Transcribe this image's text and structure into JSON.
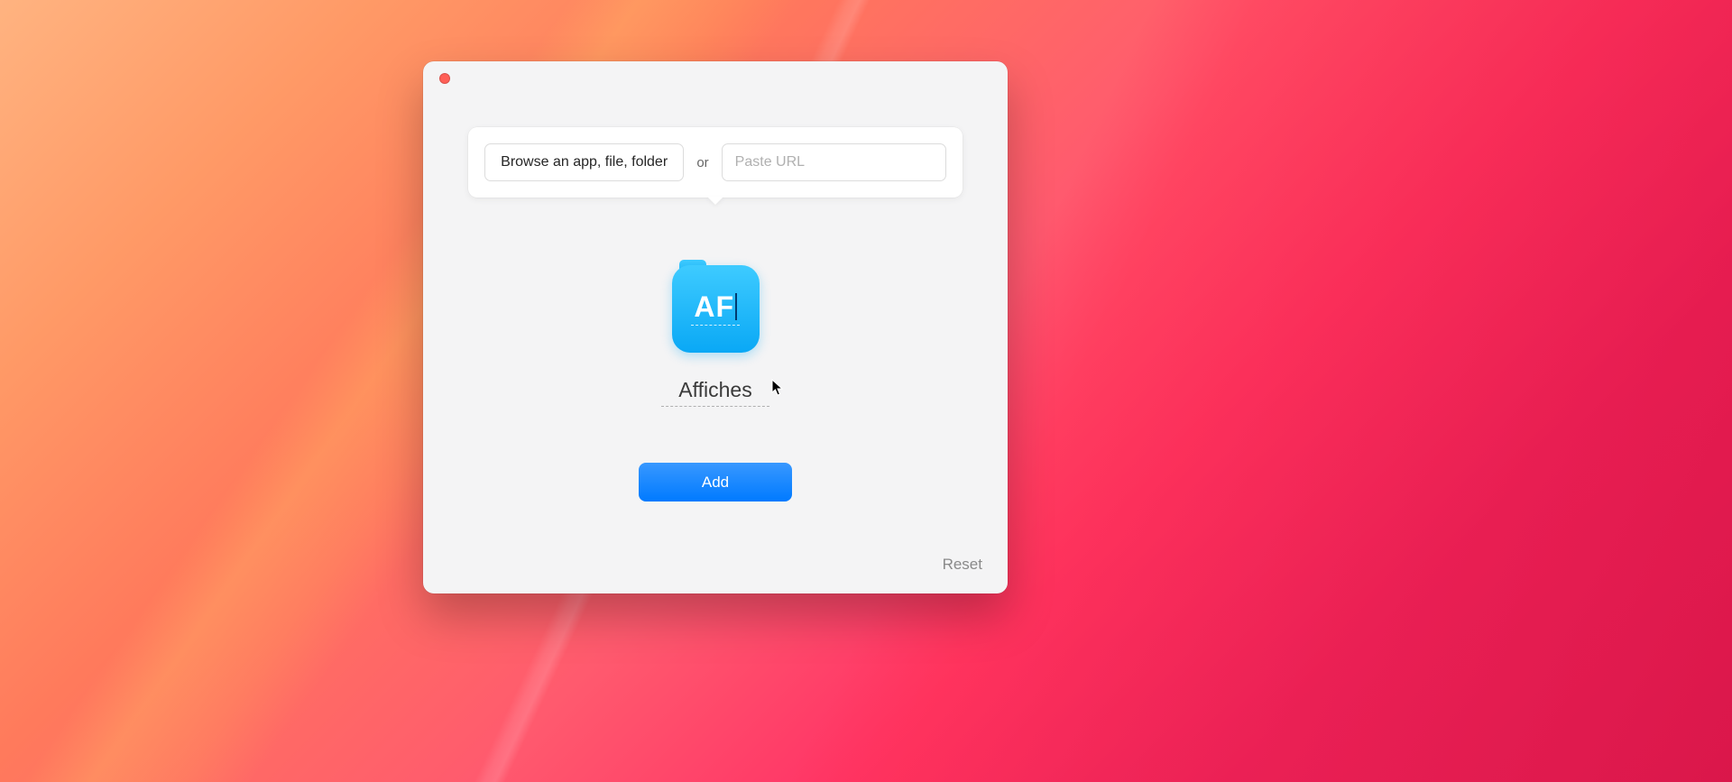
{
  "inputs": {
    "browse_label": "Browse an app, file, folder",
    "separator": "or",
    "url_placeholder": "Paste URL",
    "url_value": ""
  },
  "preview": {
    "icon_text": "AF",
    "item_name": "Affiches"
  },
  "actions": {
    "add_label": "Add",
    "reset_label": "Reset"
  }
}
